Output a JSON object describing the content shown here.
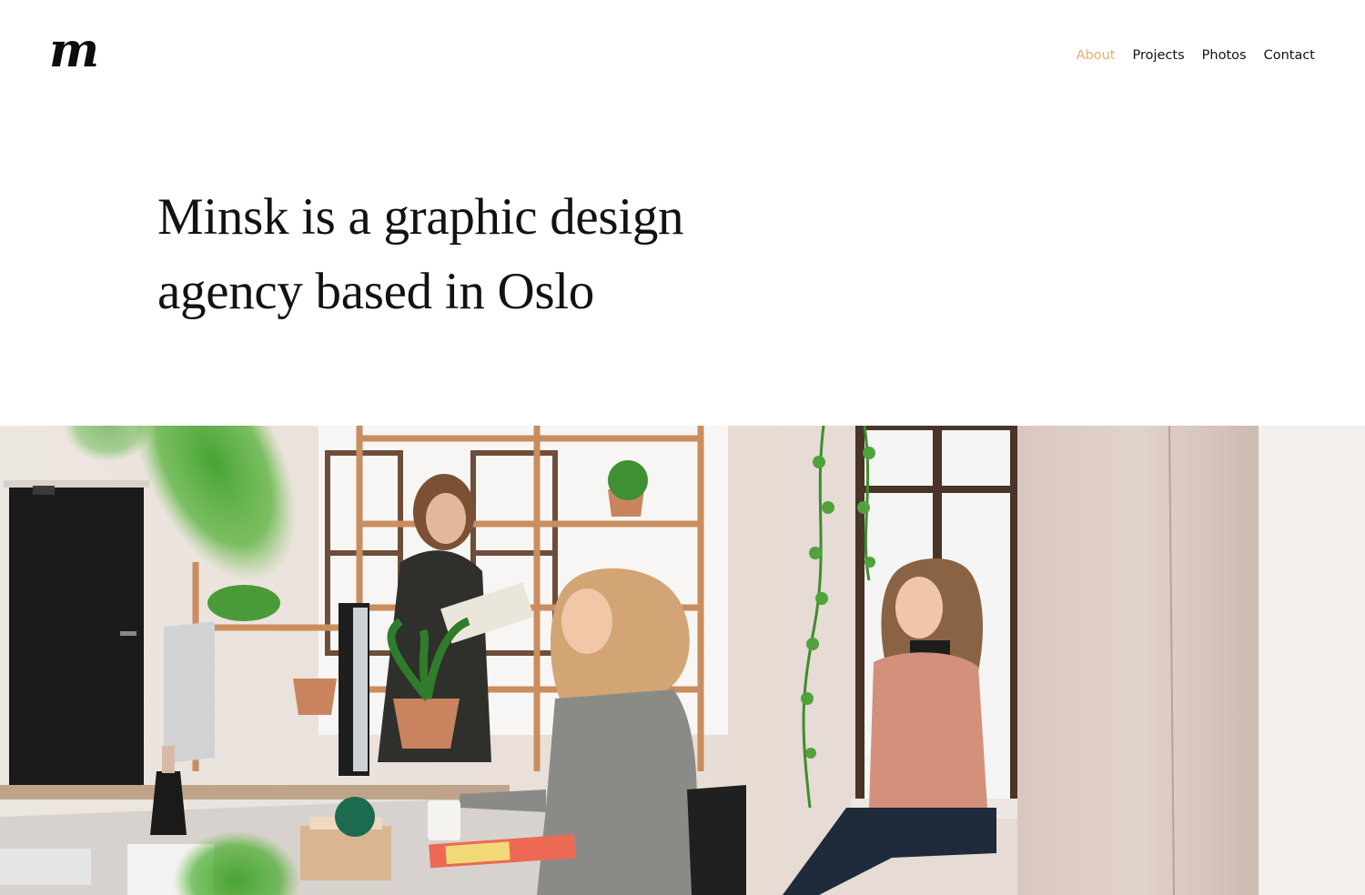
{
  "header": {
    "logo_text": "m",
    "nav": [
      {
        "label": "About",
        "active": true
      },
      {
        "label": "Projects",
        "active": false
      },
      {
        "label": "Photos",
        "active": false
      },
      {
        "label": "Contact",
        "active": false
      }
    ]
  },
  "hero": {
    "title_line1": "Minsk is a graphic design",
    "title_line2": "agency based in Oslo"
  },
  "colors": {
    "accent": "#e7ae6c",
    "text": "#111111",
    "background": "#ffffff"
  }
}
